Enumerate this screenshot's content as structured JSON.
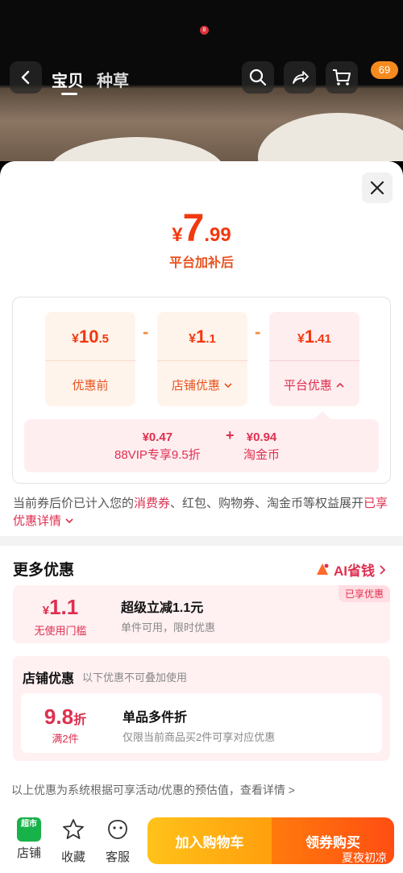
{
  "status": {
    "notification_count": "8"
  },
  "nav": {
    "tabs": [
      {
        "label": "宝贝",
        "active": true
      },
      {
        "label": "种草",
        "active": false
      }
    ],
    "cart_badge": "69",
    "icons": [
      "back-icon",
      "search-icon",
      "share-icon",
      "cart-icon"
    ]
  },
  "price": {
    "currency": "¥",
    "final_int": "7",
    "final_dec": ".99",
    "final_caption": "平台加补后"
  },
  "breakdown": {
    "original": {
      "currency": "¥",
      "int": "10",
      "dec": ".5",
      "label": "优惠前"
    },
    "shop": {
      "currency": "¥",
      "int": "1",
      "dec": ".1",
      "label": "店铺优惠"
    },
    "platform": {
      "currency": "¥",
      "int": "1",
      "dec": ".41",
      "label": "平台优惠"
    },
    "minus": "-",
    "platform_detail": [
      {
        "amount": "¥0.47",
        "label": "88VIP专享9.5折"
      },
      {
        "amount": "¥0.94",
        "label": "淘金币"
      }
    ],
    "plus": "+"
  },
  "notice": {
    "part1": "当前券后价已计入您的",
    "highlight1": "消费券",
    "part2": "、红包、购物券、淘金币等权益展开",
    "link": "已享优惠详情"
  },
  "more_offers": {
    "title": "更多优惠",
    "ai_link": "AI省钱",
    "coupon": {
      "currency": "¥",
      "value": "1.1",
      "threshold": "无使用门槛",
      "title": "超级立减1.1元",
      "desc": "单件可用，限时优惠",
      "tag": "已享优惠"
    }
  },
  "shop_offers": {
    "title": "店铺优惠",
    "note": "以下优惠不可叠加使用",
    "coupon": {
      "value": "9.8",
      "unit": "折",
      "condition": "满2件",
      "title": "单品多件折",
      "desc": "仅限当前商品买2件可享对应优惠"
    }
  },
  "disclaimer": "以上优惠为系统根据可享活动/优惠的预估值，查看详情 >",
  "bottom": {
    "shop_logo": "超市",
    "shop_label": "店铺",
    "fav_label": "收藏",
    "service_label": "客服",
    "add_cart": "加入购物车",
    "buy": "领券购买",
    "watermark": "夏夜初凉"
  },
  "colors": {
    "accent": "#f2380f",
    "pink": "#df2f4f",
    "orange": "#ff9f0d"
  }
}
